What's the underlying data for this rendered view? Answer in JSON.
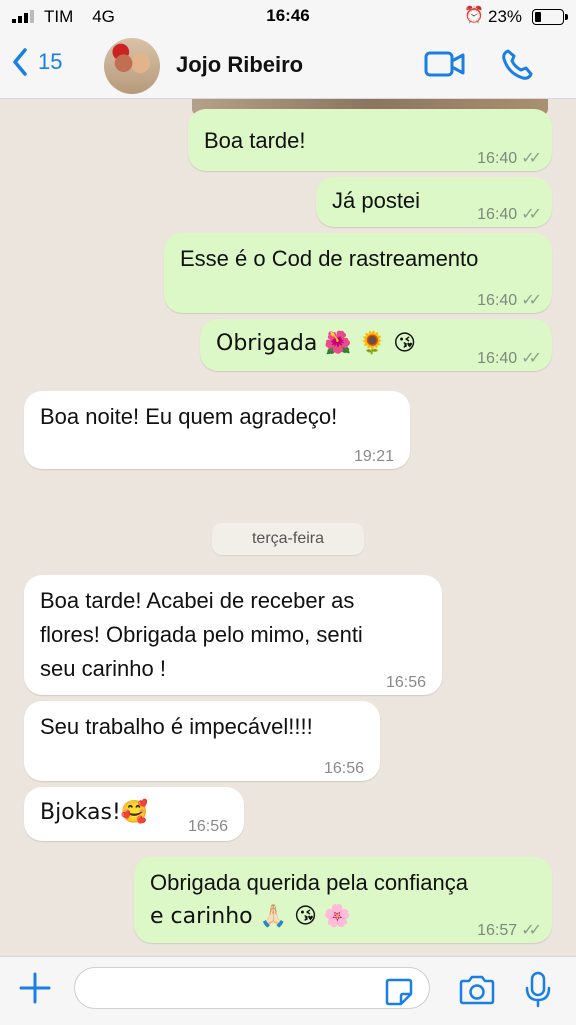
{
  "status_bar": {
    "carrier": "TIM",
    "network": "4G",
    "time": "16:46",
    "battery": "23%"
  },
  "header": {
    "back_count": "15",
    "contact_name": "Jojo Ribeiro"
  },
  "messages": [
    {
      "direction": "out",
      "text": "Boa tarde!",
      "time": "16:40"
    },
    {
      "direction": "out",
      "text": "Já postei",
      "time": "16:40"
    },
    {
      "direction": "out",
      "text": "Esse é o Cod de rastreamento",
      "time": "16:40"
    },
    {
      "direction": "out",
      "text": "Obrigada 🌺 🌻 😘",
      "time": "16:40"
    },
    {
      "direction": "in",
      "text": "Boa noite! Eu quem agradeço!",
      "time": "19:21"
    },
    {
      "direction": "in",
      "text_lines": [
        "Boa tarde! Acabei de receber as",
        "flores! Obrigada pelo mimo, senti",
        "seu carinho !"
      ],
      "time": "16:56"
    },
    {
      "direction": "in",
      "text": "Seu trabalho é impecável!!!!",
      "time": "16:56"
    },
    {
      "direction": "in",
      "text": "Bjokas!🥰",
      "time": "16:56"
    },
    {
      "direction": "out",
      "text_lines": [
        "Obrigada querida pela confiança",
        "e carinho 🙏🏻 😘 🌸"
      ],
      "time": "16:57"
    }
  ],
  "day_separator": "terça-feira",
  "input": {
    "placeholder": ""
  },
  "colors": {
    "accent": "#1a7fe5",
    "outgoing_bubble": "#dcf8c6",
    "incoming_bubble": "#ffffff",
    "chat_background": "#ece5dd"
  },
  "icons": [
    "back-chevron-icon",
    "video-call-icon",
    "phone-icon",
    "plus-icon",
    "sticker-icon",
    "camera-icon",
    "microphone-icon",
    "double-check-icon"
  ]
}
